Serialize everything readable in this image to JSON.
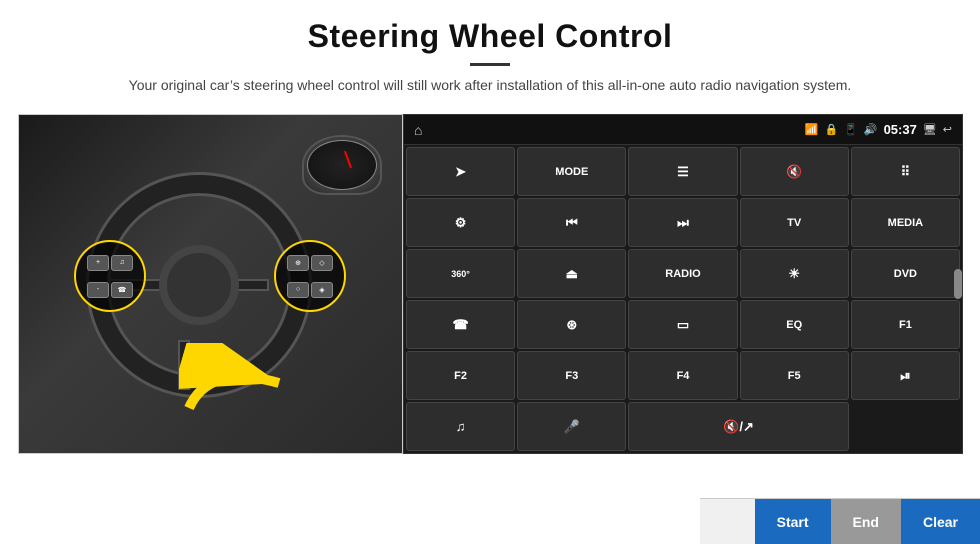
{
  "header": {
    "title": "Steering Wheel Control",
    "subtitle": "Your original car’s steering wheel control will still work after installation of this all-in-one auto radio navigation system."
  },
  "status_bar": {
    "time": "05:37",
    "icons": [
      "wifi",
      "lock",
      "sim",
      "bluetooth",
      "monitor",
      "back"
    ]
  },
  "grid_buttons": [
    {
      "id": "r1c1",
      "label": "⌂",
      "type": "icon"
    },
    {
      "id": "r1c2",
      "label": "➤",
      "type": "icon"
    },
    {
      "id": "r1c3",
      "label": "MODE",
      "type": "text"
    },
    {
      "id": "r1c4",
      "label": "☰",
      "type": "icon"
    },
    {
      "id": "r1c5",
      "label": "🔈×",
      "type": "icon"
    },
    {
      "id": "r1c6",
      "label": "⋯⋯",
      "type": "icon"
    },
    {
      "id": "r2c1",
      "label": "⚙",
      "type": "icon"
    },
    {
      "id": "r2c2",
      "label": "⏮",
      "type": "icon"
    },
    {
      "id": "r2c3",
      "label": "⏭",
      "type": "icon"
    },
    {
      "id": "r2c4",
      "label": "TV",
      "type": "text"
    },
    {
      "id": "r2c5",
      "label": "MEDIA",
      "type": "text"
    },
    {
      "id": "r3c1",
      "label": "360°",
      "type": "text"
    },
    {
      "id": "r3c2",
      "label": "⏫",
      "type": "icon"
    },
    {
      "id": "r3c3",
      "label": "RADIO",
      "type": "text"
    },
    {
      "id": "r3c4",
      "label": "☀",
      "type": "icon"
    },
    {
      "id": "r3c5",
      "label": "DVD",
      "type": "text"
    },
    {
      "id": "r4c1",
      "label": "☎",
      "type": "icon"
    },
    {
      "id": "r4c2",
      "label": "⦾",
      "type": "icon"
    },
    {
      "id": "r4c3",
      "label": "⬜",
      "type": "icon"
    },
    {
      "id": "r4c4",
      "label": "EQ",
      "type": "text"
    },
    {
      "id": "r4c5",
      "label": "F1",
      "type": "text"
    },
    {
      "id": "r5c1",
      "label": "F2",
      "type": "text"
    },
    {
      "id": "r5c2",
      "label": "F3",
      "type": "text"
    },
    {
      "id": "r5c3",
      "label": "F4",
      "type": "text"
    },
    {
      "id": "r5c4",
      "label": "F5",
      "type": "text"
    },
    {
      "id": "r5c5",
      "label": "⏯",
      "type": "icon"
    },
    {
      "id": "r6c1",
      "label": "♫",
      "type": "icon"
    },
    {
      "id": "r6c2",
      "label": "🎤",
      "type": "icon"
    },
    {
      "id": "r6c3",
      "label": "🔇/↗",
      "type": "icon"
    }
  ],
  "bottom_buttons": {
    "start": "Start",
    "end": "End",
    "clear": "Clear"
  },
  "colors": {
    "background": "#ffffff",
    "head_unit_bg": "#1a1a1a",
    "button_bg": "#2d2d2d",
    "accent_blue": "#1a6bbf",
    "text_light": "#ffffff",
    "status_bar_bg": "#111111"
  }
}
